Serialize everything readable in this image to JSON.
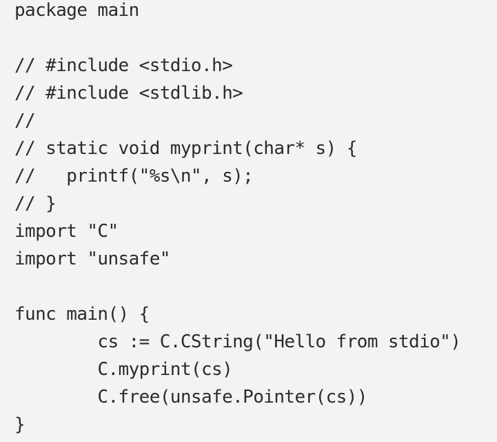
{
  "code": {
    "lines": [
      "package main",
      "",
      "// #include <stdio.h>",
      "// #include <stdlib.h>",
      "//",
      "// static void myprint(char* s) {",
      "//   printf(\"%s\\n\", s);",
      "// }",
      "import \"C\"",
      "import \"unsafe\"",
      "",
      "func main() {",
      "        cs := C.CString(\"Hello from stdio\")",
      "        C.myprint(cs)",
      "        C.free(unsafe.Pointer(cs))",
      "}"
    ]
  }
}
